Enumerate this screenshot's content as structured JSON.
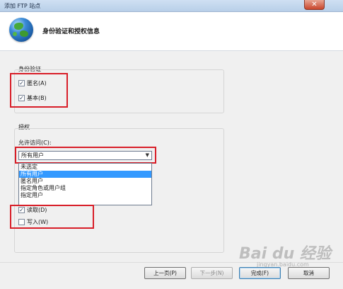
{
  "window": {
    "title": "添加 FTP 站点",
    "close_glyph": "✕"
  },
  "header": {
    "title": "身份验证和授权信息"
  },
  "authentication": {
    "label": "身份验证",
    "anonymous": {
      "label": "匿名(A)",
      "checked": true
    },
    "basic": {
      "label": "基本(B)",
      "checked": true
    }
  },
  "authorization": {
    "label": "授权",
    "allow_access_label": "允许访问(C):",
    "selected": "所有用户",
    "options": [
      "未选定",
      "所有用户",
      "匿名用户",
      "指定角色或用户组",
      "指定用户"
    ]
  },
  "permissions": {
    "read": {
      "label": "读取(D)",
      "checked": true
    },
    "write": {
      "label": "写入(W)",
      "checked": false
    }
  },
  "buttons": {
    "prev": "上一页(P)",
    "next": "下一步(N)",
    "finish": "完成(F)",
    "cancel": "取消"
  },
  "watermark": {
    "text": "Bai du 经验",
    "sub": "jingyan.baidu.com"
  },
  "colors": {
    "highlight": "#d81e28",
    "selection": "#3399ff"
  }
}
